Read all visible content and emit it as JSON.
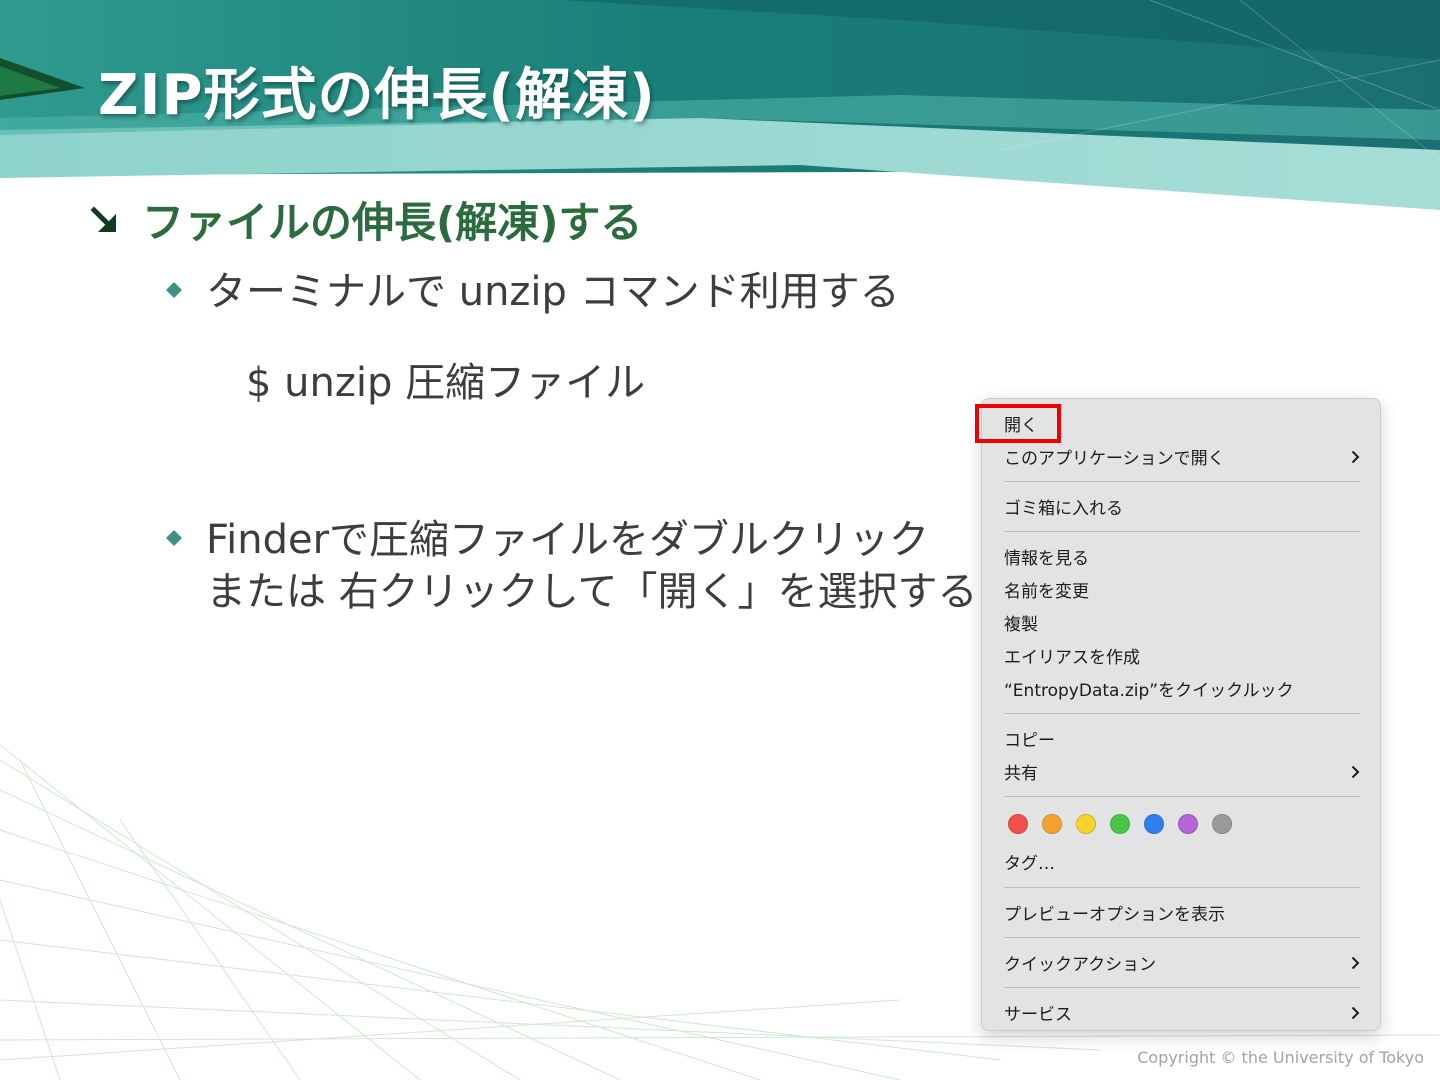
{
  "slide": {
    "title": "ZIP形式の伸長(解凍)",
    "heading": "ファイルの伸長(解凍)する",
    "bullets": [
      {
        "text": "ターミナルで unzip コマンド利用する"
      },
      {
        "line1": "Finderで圧縮ファイルをダブルクリック",
        "line2": "または 右クリックして「開く」を選択する"
      }
    ],
    "command": "$ unzip 圧縮ファイル",
    "copyright": "Copyright © the University of Tokyo"
  },
  "context_menu": {
    "items": {
      "open": "開く",
      "open_with": "このアプリケーションで開く",
      "trash": "ゴミ箱に入れる",
      "get_info": "情報を見る",
      "rename": "名前を変更",
      "duplicate": "複製",
      "make_alias": "エイリアスを作成",
      "quick_look": "“EntropyData.zip”をクイックルック",
      "copy": "コピー",
      "share": "共有",
      "tags": "タグ…",
      "show_preview_options": "プレビューオプションを表示",
      "quick_actions": "クイックアクション",
      "services": "サービス"
    },
    "tag_colors": [
      "#f1504c",
      "#f5a233",
      "#f6d42e",
      "#4ac74b",
      "#2f7ff0",
      "#b565d8",
      "#9a9a9c"
    ]
  },
  "colors": {
    "title_text": "#ffffff",
    "heading_text": "#2b6b3e",
    "bullet_marker": "#3f8f83",
    "highlight": "#ee0000",
    "menu_background": "#e3e3e3"
  }
}
